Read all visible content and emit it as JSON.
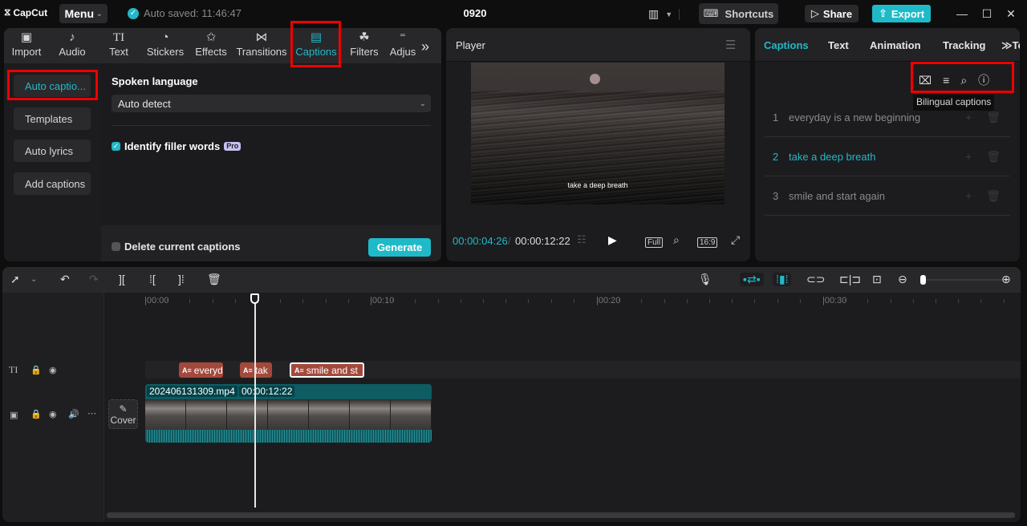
{
  "titlebar": {
    "app_name": "CapCut",
    "menu_label": "Menu",
    "autosave": "Auto saved: 11:46:47",
    "project_title": "0920",
    "shortcuts_label": "Shortcuts",
    "share_label": "Share",
    "export_label": "Export"
  },
  "media_tabs": [
    {
      "label": "Import",
      "icon": "import-icon"
    },
    {
      "label": "Audio",
      "icon": "audio-icon"
    },
    {
      "label": "Text",
      "icon": "text-icon"
    },
    {
      "label": "Stickers",
      "icon": "stickers-icon"
    },
    {
      "label": "Effects",
      "icon": "effects-icon"
    },
    {
      "label": "Transitions",
      "icon": "transitions-icon"
    },
    {
      "label": "Captions",
      "icon": "captions-icon",
      "active": true
    },
    {
      "label": "Filters",
      "icon": "filters-icon"
    },
    {
      "label": "Adjus",
      "icon": "adjust-icon"
    }
  ],
  "captions_nav": {
    "items": [
      "Auto captio...",
      "Templates",
      "Auto lyrics",
      "Add captions"
    ],
    "active_index": 0
  },
  "auto_captions": {
    "spoken_language_label": "Spoken language",
    "spoken_language_value": "Auto detect",
    "filler_words_label": "Identify filler words",
    "filler_words_checked": true,
    "pro_badge": "Pro",
    "delete_current_label": "Delete current captions",
    "delete_current_checked": false,
    "generate_label": "Generate"
  },
  "player": {
    "title": "Player",
    "video_caption": "take a deep breath",
    "current_time": "00:00:04:26",
    "separator": "/",
    "total_time": "00:00:12:22",
    "full_label": "Full",
    "ratio_label": "16:9"
  },
  "right_panel": {
    "tabs": [
      "Captions",
      "Text",
      "Animation",
      "Tracking",
      "Tex"
    ],
    "active_tab": 0,
    "tooltip": "Bilingual captions",
    "captions": [
      {
        "num": "1",
        "text": "everyday is a new beginning"
      },
      {
        "num": "2",
        "text": "take a deep breath",
        "active": true
      },
      {
        "num": "3",
        "text": "smile and start again"
      }
    ]
  },
  "timeline": {
    "ruler_labels": [
      "00:00",
      "00:10",
      "00:20",
      "00:30"
    ],
    "caption_clips": [
      "everyd",
      "tak",
      "smile and st"
    ],
    "video_clip_name": "202406131309.mp4",
    "video_clip_duration": "00:00:12:22",
    "cover_label": "Cover",
    "zoom_level": 0.03
  },
  "colors": {
    "accent": "#22b8c8",
    "caption_clip": "#a3493c",
    "video_clip": "#0f5c62",
    "highlight": "#e00000"
  }
}
